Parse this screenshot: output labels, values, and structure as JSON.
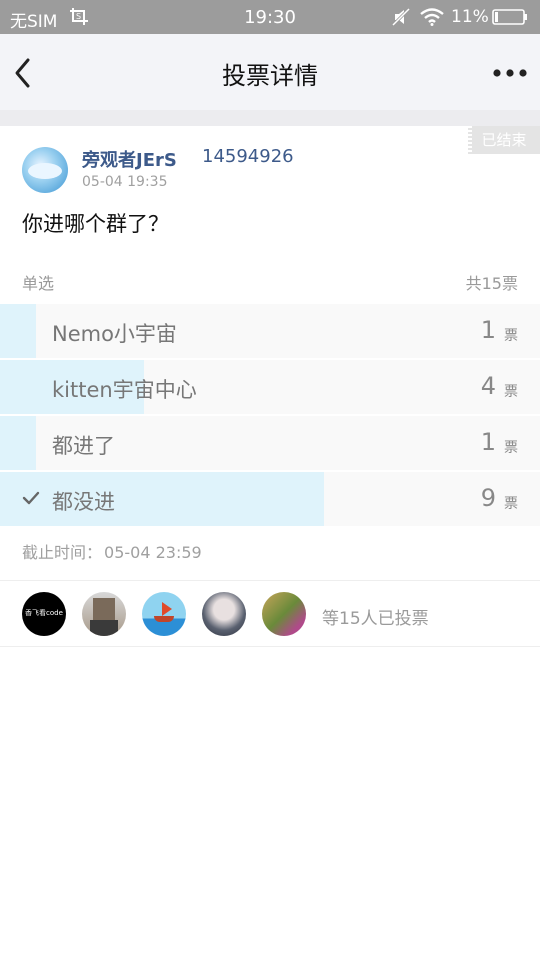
{
  "status_bar": {
    "carrier": "无SIM",
    "time": "19:30",
    "battery": "11%"
  },
  "nav": {
    "title": "投票详情"
  },
  "badge": {
    "ended": "已结束"
  },
  "post": {
    "username": "旁观者JErS",
    "user_id": "14594926",
    "time": "05-04 19:35",
    "question": "你进哪个群了？"
  },
  "vote": {
    "type": "单选",
    "total": "共15票",
    "unit": "票",
    "options": [
      {
        "label": "Nemo小宇宙",
        "count": "1",
        "fraction": 0.0667,
        "selected": false
      },
      {
        "label": "kitten宇宙中心",
        "count": "4",
        "fraction": 0.2667,
        "selected": false
      },
      {
        "label": "都进了",
        "count": "1",
        "fraction": 0.0667,
        "selected": false
      },
      {
        "label": "都没进",
        "count": "9",
        "fraction": 0.6,
        "selected": true
      }
    ],
    "deadline_label": "截止时间：",
    "deadline_time": "05-04 23:59"
  },
  "voters": {
    "avatar1_text": "香飞看code",
    "summary": "等15人已投票"
  },
  "colors": {
    "accent_fill": "#dff3fb",
    "name_blue": "#3d5a8a",
    "status_bar": "#9c9c9c"
  }
}
